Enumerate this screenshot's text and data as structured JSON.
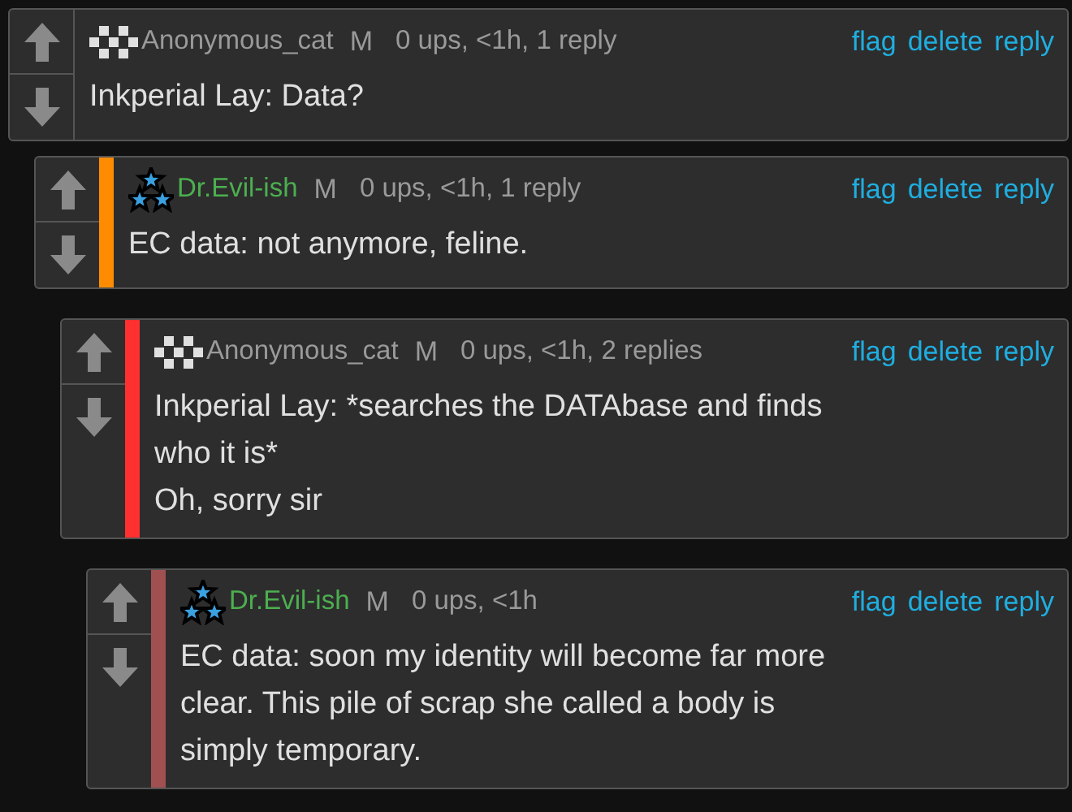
{
  "comments": [
    {
      "avatar": {
        "kind": "checker"
      },
      "user": {
        "name": "Anonymous_cat",
        "color": "#9a9a9a"
      },
      "badge": "M",
      "stats": "0 ups, <1h, 1 reply",
      "actions": [
        "flag",
        "delete",
        "reply"
      ],
      "lines": [
        "Inkperial Lay: Data?"
      ],
      "children": [
        {
          "avatar": {
            "kind": "stars"
          },
          "user": {
            "name": "Dr.Evil-ish",
            "color": "#4caf50"
          },
          "badge": "M",
          "stats": "0 ups, <1h, 1 reply",
          "actions": [
            "flag",
            "delete",
            "reply"
          ],
          "bar": {
            "color": "#ff8c00"
          },
          "lines": [
            "EC data: not anymore, feline."
          ],
          "children": [
            {
              "avatar": {
                "kind": "checker"
              },
              "user": {
                "name": "Anonymous_cat",
                "color": "#9a9a9a"
              },
              "badge": "M",
              "stats": "0 ups, <1h, 2 replies",
              "actions": [
                "flag",
                "delete",
                "reply"
              ],
              "bar": {
                "color": "#ff3030"
              },
              "lines": [
                "Inkperial Lay: *searches the DATAbase and finds",
                "who it is*",
                "Oh, sorry sir"
              ],
              "children": [
                {
                  "avatar": {
                    "kind": "stars"
                  },
                  "user": {
                    "name": "Dr.Evil-ish",
                    "color": "#4caf50"
                  },
                  "badge": "M",
                  "stats": "0 ups, <1h",
                  "actions": [
                    "flag",
                    "delete",
                    "reply"
                  ],
                  "bar": {
                    "color": "#a05050"
                  },
                  "lines": [
                    "EC data: soon my identity will become far more",
                    "clear. This pile of scrap she called a body is",
                    "simply temporary."
                  ]
                }
              ]
            }
          ]
        }
      ]
    }
  ]
}
